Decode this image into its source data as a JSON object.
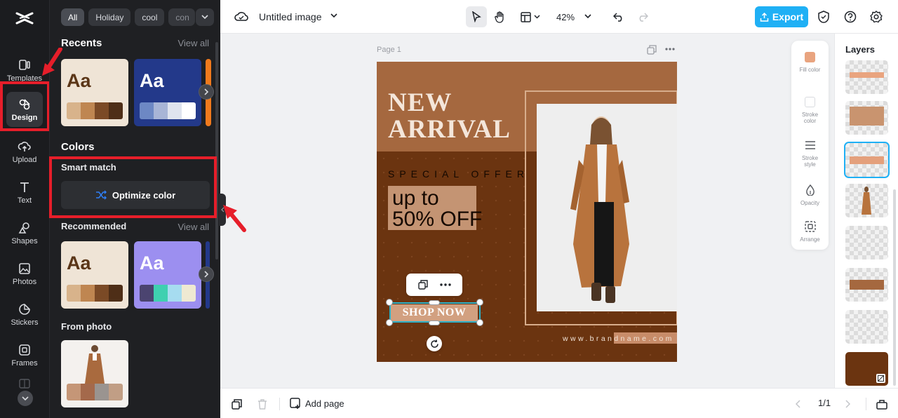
{
  "rail": {
    "items": [
      {
        "label": "Templates"
      },
      {
        "label": "Design"
      },
      {
        "label": "Upload"
      },
      {
        "label": "Text"
      },
      {
        "label": "Shapes"
      },
      {
        "label": "Photos"
      },
      {
        "label": "Stickers"
      },
      {
        "label": "Frames"
      }
    ]
  },
  "panel": {
    "chips": [
      "All",
      "Holiday",
      "cool",
      "con"
    ],
    "recents": {
      "title": "Recents",
      "view_all": "View all"
    },
    "colors": {
      "title": "Colors",
      "smart_match": "Smart match",
      "optimize": "Optimize color"
    },
    "recommended": {
      "title": "Recommended",
      "view_all": "View all"
    },
    "from_photo": {
      "title": "From photo"
    },
    "card_text": "Aa",
    "palettes": {
      "recent_1": [
        "#d8b38b",
        "#bf8651",
        "#7b4a26",
        "#4e2e17"
      ],
      "recent_2": [
        "#6d88c4",
        "#a8b5d6",
        "#dfe4ee",
        "#ffffff"
      ],
      "rec_1": [
        "#d8b38b",
        "#bf8651",
        "#7b4a26",
        "#4e2e17"
      ],
      "rec_2": [
        "#4b4470",
        "#3fd0b0",
        "#a6dcf0",
        "#efe9d2"
      ],
      "photo": [
        "#c59677",
        "#a4694b",
        "#9a9490",
        "#c19e85"
      ]
    }
  },
  "topbar": {
    "title": "Untitled image",
    "zoom": "42%",
    "export": "Export"
  },
  "canvas": {
    "page_label": "Page 1",
    "headline": "NEW ARRIVAL",
    "special": "SPECIAL OFFER",
    "promo_line1": "up to",
    "promo_line2": "50% OFF",
    "shop": "SHOP NOW",
    "url": "www.brandname.com"
  },
  "props": {
    "fill": "Fill color",
    "stroke": "Stroke color",
    "stroke_style": "Stroke style",
    "opacity": "Opacity",
    "arrange": "Arrange"
  },
  "layers": {
    "title": "Layers"
  },
  "bottombar": {
    "add_page": "Add page",
    "pages": "1/1"
  },
  "colors": {
    "accent": "#1fb0f5",
    "highlight": "#e61e2a",
    "design_bg": "#6b3410",
    "design_band": "#a5683f"
  }
}
